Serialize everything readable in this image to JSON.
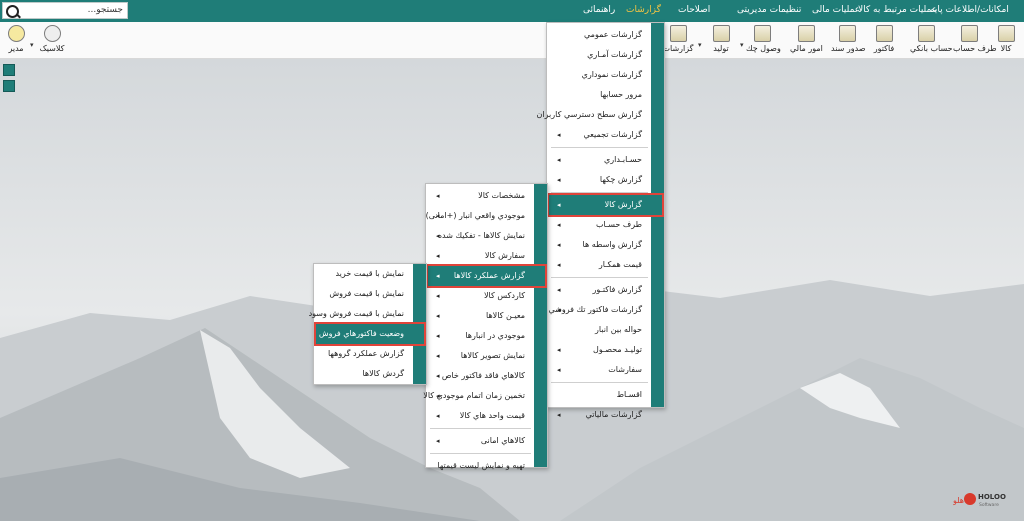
{
  "search": {
    "placeholder": "جستجو..."
  },
  "top_menu": {
    "basic": "امکانات/اطلاعات پایه",
    "goods_ops": "عملیات مرتبط به کالا",
    "financial": "عملیات مالی",
    "settings": "تنظیمات مدیریتی",
    "corrections": "اصلاحات",
    "reports": "گزارشات",
    "help": "راهنمائی"
  },
  "toolbar": {
    "goods": "کالا",
    "party": "طرف حساب",
    "bank_account": "حساب بانکي",
    "invoice": "فاکتور",
    "voucher": "صدور سند",
    "finance": "امور مالي",
    "cheque_receipt": "وصول چك",
    "production": "توليد",
    "reports": "گزارشات",
    "classic": "كلاسيک",
    "manager": "مدیر"
  },
  "reports_menu": [
    "گزارشات عمومي",
    "گزارشات آمـاري",
    "گزارشات نموداري",
    "مرور حسابها",
    "گزارش سطح دسترسي کاربران",
    "گزارشات تجمیعي",
    "حسـابـداري",
    "گزارش چکها",
    "گزارش کالا",
    "طرف حسـاب",
    "گزارش واسطه ها",
    "قيمت همكـار",
    "گزارش فاكتـور",
    "گزارشات فاكتور تك فروشي",
    "حواله بين انبار",
    "تولیـد محصـول",
    "سفارشات",
    "اقسـاط",
    "گزارشات مالیاتي"
  ],
  "goods_menu": [
    "مشخصات كالا",
    "موجودي واقعي انبار (+امانی)",
    "نمايش كالاها - تفكيك شده",
    "سفارش كالا",
    "گزارش عملكرد كالاها",
    "كاردكس كالا",
    "معيـن كالاها",
    "موجودي در انبارها",
    "نمايش تصوير كالاها",
    "كالاهاي فاقد فاكتور خاص",
    "تخمين زمان اتمام موجودي كالا",
    "قيمت واحد هاي كالا",
    "كالاهاي امانی",
    "تهيه و نمايش ليست قيمتها"
  ],
  "perf_menu": [
    "نمايش با قيمت خريد",
    "نمايش با قيمت فروش",
    "نمايش با قيمت فروش وسود",
    "وضعيت فاكتورهاي فروش",
    "گزارش عملكرد گروهها",
    "گردش كالاها"
  ],
  "logo": {
    "brand": "HOLOO",
    "sub": "Software",
    "fa": "هلو"
  },
  "colors": {
    "teal": "#1f7d78",
    "highlight_border": "#e0443a",
    "active_menu": "#f5c542"
  }
}
